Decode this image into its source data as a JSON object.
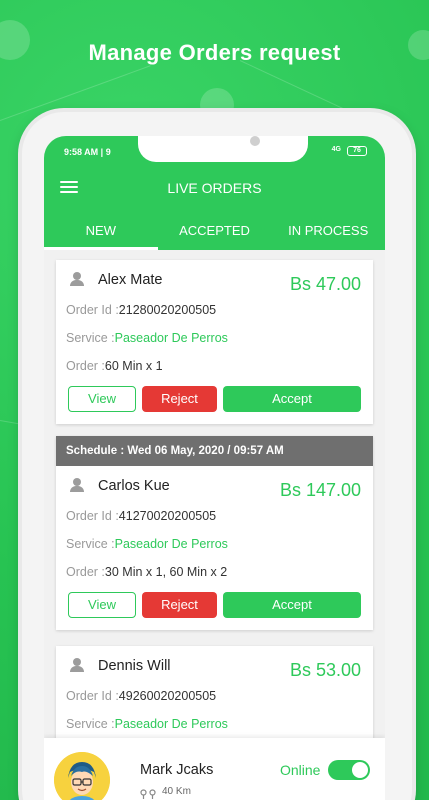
{
  "headline": "Manage Orders request",
  "statusbar": {
    "time": "9:58 AM | 9",
    "signal": "4G",
    "battery": "76"
  },
  "appbar": {
    "title": "LIVE ORDERS",
    "menu_icon": "hamburger-menu-icon"
  },
  "tabs": [
    {
      "label": "NEW",
      "active": true
    },
    {
      "label": "ACCEPTED",
      "active": false
    },
    {
      "label": "IN PROCESS",
      "active": false
    }
  ],
  "orders": [
    {
      "schedule": "",
      "customer": "Alex Mate",
      "price": "Bs 47.00",
      "order_id_label": "Order Id :",
      "order_id": "21280020200505",
      "service_label": "Service :",
      "service": "Paseador De Perros",
      "order_label": "Order :",
      "order": "60 Min x 1",
      "view_label": "View",
      "reject_label": "Reject",
      "accept_label": "Accept"
    },
    {
      "schedule": "Schedule : Wed 06 May, 2020 / 09:57 AM",
      "customer": "Carlos Kue",
      "price": "Bs 147.00",
      "order_id_label": "Order Id :",
      "order_id": "41270020200505",
      "service_label": "Service :",
      "service": "Paseador De Perros",
      "order_label": "Order :",
      "order": "30 Min x 1, 60 Min x 2",
      "view_label": "View",
      "reject_label": "Reject",
      "accept_label": "Accept"
    },
    {
      "schedule": "",
      "customer": "Dennis Will",
      "price": "Bs 53.00",
      "order_id_label": "Order Id :",
      "order_id": "49260020200505",
      "service_label": "Service :",
      "service": "Paseador De Perros"
    }
  ],
  "driver": {
    "name": "Mark Jcaks",
    "distance": "40 Km",
    "online_label": "Online",
    "online": true
  },
  "colors": {
    "accent": "#2ec95a",
    "reject": "#e53935",
    "schedule_bar": "#6f6f6f"
  }
}
